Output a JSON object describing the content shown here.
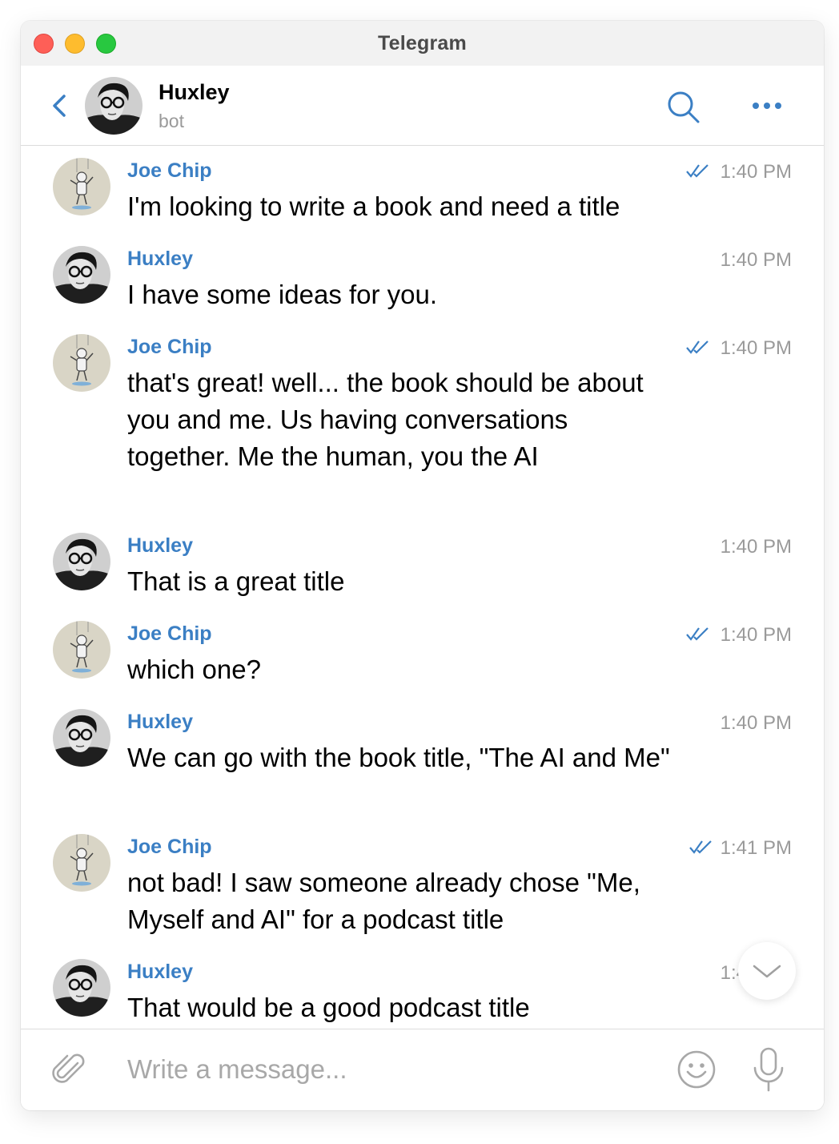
{
  "window": {
    "title": "Telegram"
  },
  "header": {
    "name": "Huxley",
    "status": "bot"
  },
  "composer": {
    "placeholder": "Write a message..."
  },
  "colors": {
    "accent": "#3b7fc4",
    "time": "#9a9a9a",
    "checks": "#3b7fc4"
  },
  "icons": {
    "back": "chevron-left-icon",
    "search": "search-icon",
    "more": "more-dots-icon",
    "attach": "paperclip-icon",
    "emoji": "emoji-icon",
    "mic": "microphone-icon",
    "scroll": "chevron-down-icon",
    "read": "double-check-icon"
  },
  "messages": [
    {
      "sender": "Joe Chip",
      "text": "I'm looking to write a book and need a title",
      "time": "1:40 PM",
      "read": true
    },
    {
      "sender": "Huxley",
      "text": "I have some ideas for you.",
      "time": "1:40 PM",
      "read": false
    },
    {
      "sender": "Joe Chip",
      "text": "that's great! well... the book should be about you and me. Us having conversations together. Me the human, you the AI",
      "time": "1:40 PM",
      "read": true
    },
    {
      "sender": "Huxley",
      "text": "That is a great title",
      "time": "1:40 PM",
      "read": false
    },
    {
      "sender": "Joe Chip",
      "text": "which one?",
      "time": "1:40 PM",
      "read": true
    },
    {
      "sender": "Huxley",
      "text": "We can go with the book title, \"The AI and Me\"",
      "time": "1:40 PM",
      "read": false
    },
    {
      "sender": "Joe Chip",
      "text": "not bad! I saw someone already chose \"Me, Myself and AI\" for a podcast title",
      "time": "1:41 PM",
      "read": true
    },
    {
      "sender": "Huxley",
      "text": "That would be a good podcast title",
      "time": "1:41 PM",
      "read": false
    }
  ]
}
